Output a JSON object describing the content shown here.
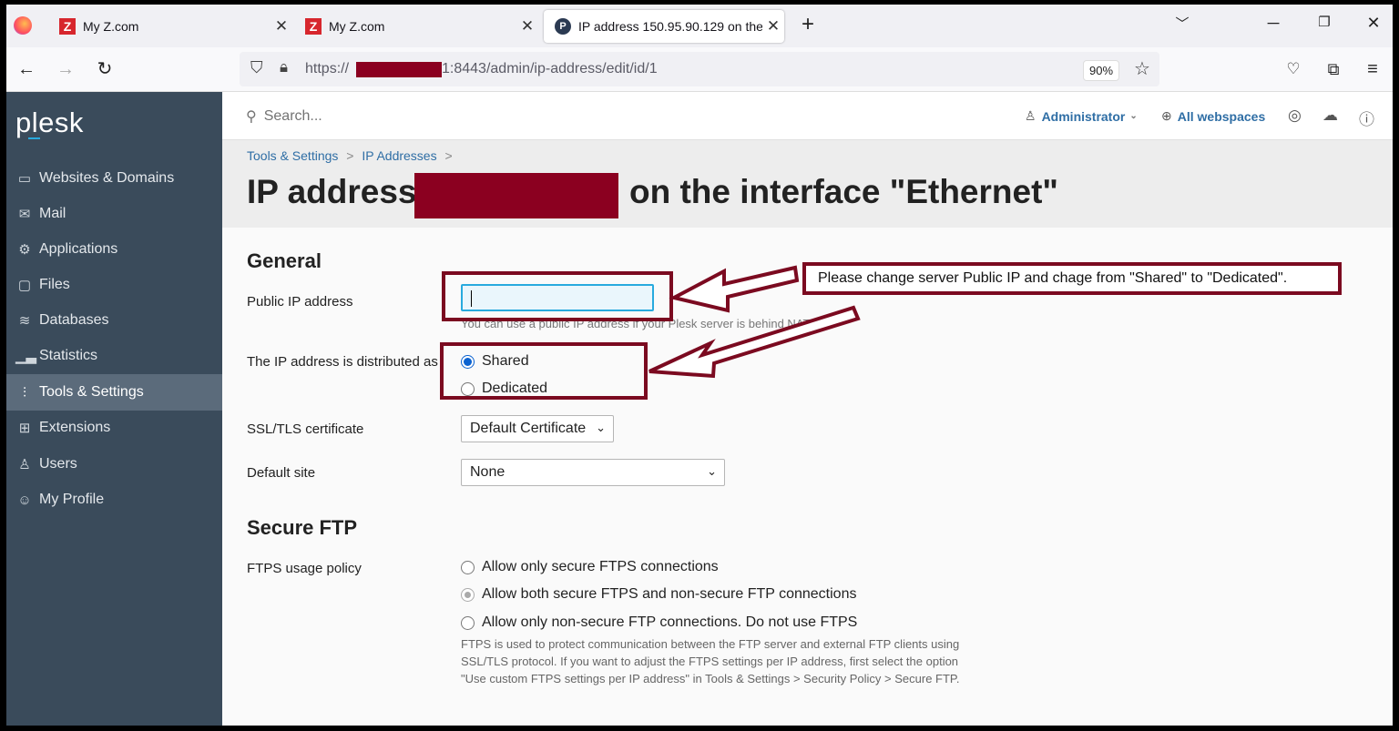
{
  "browser": {
    "tabs": [
      {
        "label": "My Z.com",
        "logo": "Z"
      },
      {
        "label": "My Z.com",
        "logo": "Z"
      },
      {
        "label": "IP address 150.95.90.129 on the",
        "logo": "P"
      }
    ],
    "new_tab": "+",
    "url_prefix": "https://",
    "url_suffix": ":8443/admin/ip-address/edit/id/1",
    "url_visible_digit": "1",
    "zoom": "90%"
  },
  "sidebar": {
    "brand": "plesk",
    "items": [
      {
        "label": "Websites & Domains",
        "icon": "monitor-icon"
      },
      {
        "label": "Mail",
        "icon": "envelope-icon"
      },
      {
        "label": "Applications",
        "icon": "gear-icon"
      },
      {
        "label": "Files",
        "icon": "folder-icon"
      },
      {
        "label": "Databases",
        "icon": "layers-icon"
      },
      {
        "label": "Statistics",
        "icon": "bar-chart-icon"
      },
      {
        "label": "Tools & Settings",
        "icon": "sliders-icon",
        "active": true
      },
      {
        "label": "Extensions",
        "icon": "grid-icon"
      },
      {
        "label": "Users",
        "icon": "user-icon"
      },
      {
        "label": "My Profile",
        "icon": "profile-icon"
      }
    ]
  },
  "header": {
    "search_placeholder": "Search...",
    "user": "Administrator",
    "workspaces": "All webspaces"
  },
  "breadcrumb": {
    "items": [
      "Tools & Settings",
      "IP Addresses"
    ],
    "separator": ">"
  },
  "title": {
    "prefix": "IP address",
    "suffix": "on the interface \"Ethernet\""
  },
  "general": {
    "heading": "General",
    "public_ip_label": "Public IP address",
    "public_ip_value": "",
    "public_ip_hint": "You can use a public IP address if your Plesk server is behind NAT.",
    "distribution_label": "The IP address is distributed as",
    "distribution_options": [
      "Shared",
      "Dedicated"
    ],
    "distribution_selected": "Shared",
    "ssl_label": "SSL/TLS certificate",
    "ssl_value": "Default Certificate",
    "default_site_label": "Default site",
    "default_site_value": "None"
  },
  "secure_ftp": {
    "heading": "Secure FTP",
    "policy_label": "FTPS usage policy",
    "options": [
      "Allow only secure FTPS connections",
      "Allow both secure FTPS and non-secure FTP connections",
      "Allow only non-secure FTP connections. Do not use FTPS"
    ],
    "selected": "Allow both secure FTPS and non-secure FTP connections",
    "note": "FTPS is used to protect communication between the FTP server and external FTP clients using SSL/TLS protocol. If you want to adjust the FTPS settings per IP address, first select the option \"Use custom FTPS settings per IP address\" in Tools & Settings > Security Policy > Secure FTP."
  },
  "annotation": {
    "callout": "Please change server Public IP and chage from \"Shared\" to \"Dedicated\".",
    "color": "#7b0a20"
  }
}
